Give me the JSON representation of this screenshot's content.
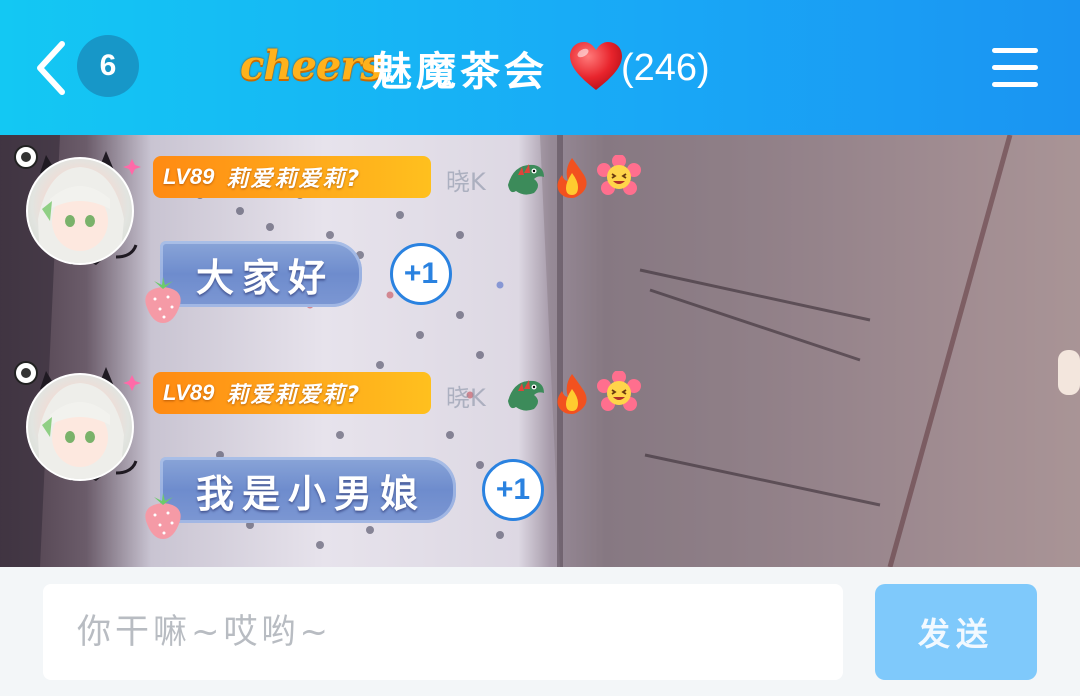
{
  "header": {
    "back_icon": "chevron-left-icon",
    "unread_count": "6",
    "brand_logo_text": "cheers",
    "room_title": "魅魔茶会",
    "heart_emoji": "heart-icon",
    "member_count": "(246)",
    "menu_icon": "hamburger-menu-icon"
  },
  "messages": [
    {
      "level": "LV89",
      "nickname": "莉爱莉爱莉?",
      "user_suffix": "晓K",
      "badges": [
        "dragon-emoji",
        "fire-emoji",
        "laughing-flower-emoji"
      ],
      "text": "大家好",
      "plus_one": "+1"
    },
    {
      "level": "LV89",
      "nickname": "莉爱莉爱莉?",
      "user_suffix": "晓K",
      "badges": [
        "dragon-emoji",
        "fire-emoji",
        "laughing-flower-emoji"
      ],
      "text": "我是小男娘",
      "plus_one": "+1"
    }
  ],
  "input": {
    "placeholder": "你干嘛~哎哟~",
    "value": "",
    "send_label": "发送"
  },
  "colors": {
    "header_start": "#13c8f3",
    "header_end": "#1a94f2",
    "badge_orange": "#ff8a12",
    "send_button": "#7fc9fb",
    "plus_one_blue": "#2a82e0"
  }
}
